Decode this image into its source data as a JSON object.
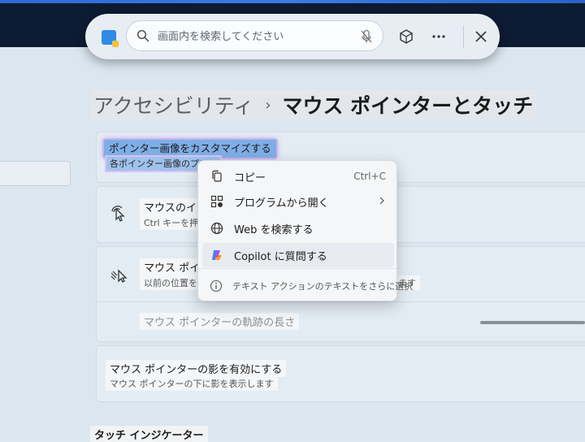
{
  "search": {
    "placeholder": "画面内を検索してください"
  },
  "breadcrumb": {
    "parent": "アクセシビリティ",
    "separator": "›",
    "current": "マウス ポインターとタッチ"
  },
  "settings": {
    "customize_title": "ポインター画像をカスタマイズする",
    "customize_sub": "各ポインター画像のプレ…",
    "locate_title": "マウスのイン…",
    "locate_sub": "Ctrl キーを押し…",
    "trails_title": "マウス ポイン…",
    "trails_sub": "以前の位置を…",
    "trails_sub_tail": "ます",
    "trail_length_label": "マウス ポインターの軌跡の長さ",
    "trail_length_value": 0.78,
    "shadow_title": "マウス ポインターの影を有効にする",
    "shadow_sub": "マウス ポインターの下に影を表示します",
    "touch_heading": "タッチ インジケーター"
  },
  "context_menu": {
    "copy": {
      "label": "コピー",
      "shortcut": "Ctrl+C"
    },
    "open_with": {
      "label": "プログラムから開く"
    },
    "web_search": {
      "label": "Web を検索する"
    },
    "copilot": {
      "label": "Copilot に質問する"
    },
    "text_actions": {
      "label": "テキスト アクションのテキストをさらに選択"
    }
  }
}
